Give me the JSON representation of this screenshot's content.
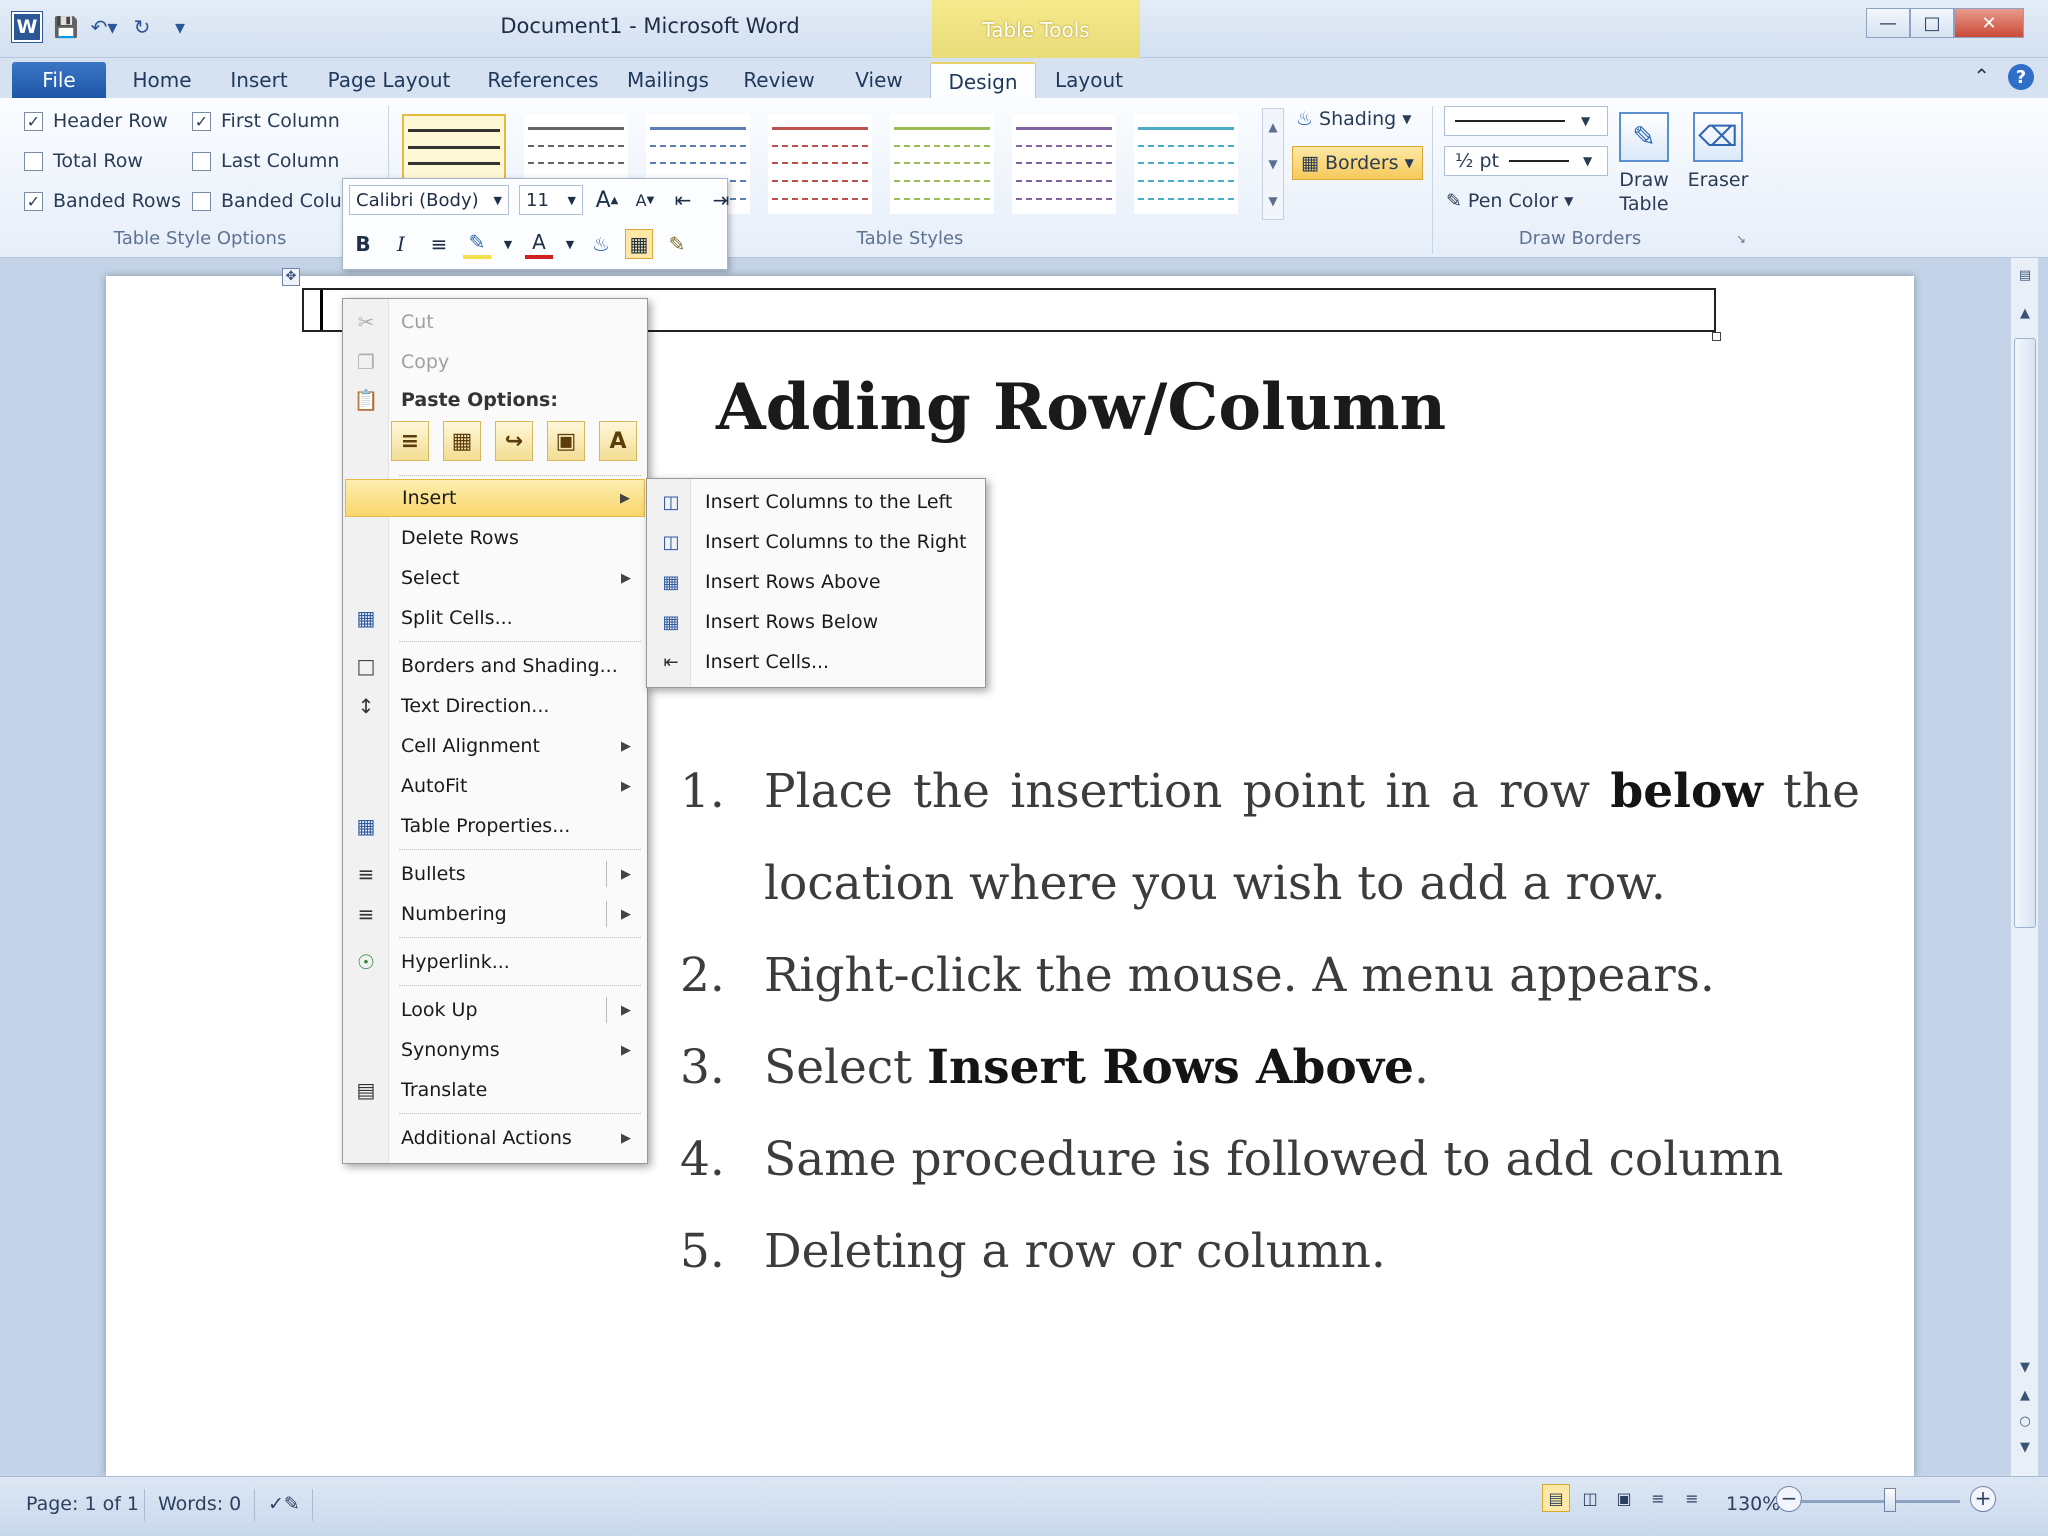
{
  "window": {
    "title": "Document1  -  Microsoft Word",
    "contextual_tab": "Table Tools",
    "controls": [
      "minimize",
      "maximize",
      "close"
    ]
  },
  "qat": {
    "icons": [
      "word-logo-icon",
      "save-icon",
      "undo-icon",
      "redo-icon",
      "customize-icon"
    ],
    "logo_letter": "W"
  },
  "tabs": [
    {
      "label": "File"
    },
    {
      "label": "Home"
    },
    {
      "label": "Insert"
    },
    {
      "label": "Page Layout"
    },
    {
      "label": "References"
    },
    {
      "label": "Mailings"
    },
    {
      "label": "Review"
    },
    {
      "label": "View"
    },
    {
      "label": "Design"
    },
    {
      "label": "Layout"
    }
  ],
  "ribbon": {
    "table_style_options": {
      "label": "Table Style Options",
      "options": [
        {
          "label": "Header Row",
          "checked": true
        },
        {
          "label": "First Column",
          "checked": true
        },
        {
          "label": "Total Row",
          "checked": false
        },
        {
          "label": "Last Column",
          "checked": false
        },
        {
          "label": "Banded Rows",
          "checked": true
        },
        {
          "label": "Banded Colu",
          "checked": false
        }
      ]
    },
    "table_styles": {
      "label": "Table Styles",
      "shading": "Shading",
      "borders": "Borders",
      "thumb_colors": [
        "#333333",
        "#666666",
        "#5b7fb5",
        "#c0504d",
        "#9bbb59",
        "#8064a2",
        "#4bacc6"
      ]
    },
    "draw_borders": {
      "label": "Draw Borders",
      "line_weight": "½ pt",
      "pen_color": "Pen Color",
      "draw_table": "Draw Table",
      "eraser": "Eraser"
    }
  },
  "mini_toolbar": {
    "font": "Calibri (Body)",
    "size": "11",
    "grow_font": "A",
    "shrink_font": "A",
    "bold": "B",
    "italic": "I",
    "font_color": "A"
  },
  "document": {
    "heading": "Adding Row/Column",
    "steps": [
      {
        "num": "1.",
        "before": "Place the insertion point in a row ",
        "bold": "below",
        "after": " the location where you wish to add a row."
      },
      {
        "num": "2.",
        "before": "Right-click the mouse. A menu appears.",
        "bold": "",
        "after": ""
      },
      {
        "num": "3.",
        "before": "Select ",
        "bold": "Insert Rows Above",
        "after": "."
      },
      {
        "num": "4.",
        "before": "Same procedure is followed to add column",
        "bold": "",
        "after": ""
      },
      {
        "num": "5.",
        "before": "Deleting a row or column.",
        "bold": "",
        "after": ""
      }
    ]
  },
  "context_menu": {
    "cut": "Cut",
    "copy": "Copy",
    "paste_options": "Paste Options:",
    "paste_letter": "A",
    "insert": "Insert",
    "delete_rows": "Delete Rows",
    "select": "Select",
    "split_cells": "Split Cells...",
    "borders_shading": "Borders and Shading...",
    "text_direction": "Text Direction...",
    "cell_alignment": "Cell Alignment",
    "autofit": "AutoFit",
    "table_properties": "Table Properties...",
    "bullets": "Bullets",
    "numbering": "Numbering",
    "hyperlink": "Hyperlink...",
    "look_up": "Look Up",
    "synonyms": "Synonyms",
    "translate": "Translate",
    "additional_actions": "Additional Actions"
  },
  "insert_submenu": {
    "cols_left": "Insert Columns to the Left",
    "cols_right": "Insert Columns to the Right",
    "rows_above": "Insert Rows Above",
    "rows_below": "Insert Rows Below",
    "cells": "Insert Cells..."
  },
  "status_bar": {
    "page": "Page: 1 of 1",
    "words": "Words: 0",
    "zoom": "130%",
    "zoom_level_percent": 130
  }
}
